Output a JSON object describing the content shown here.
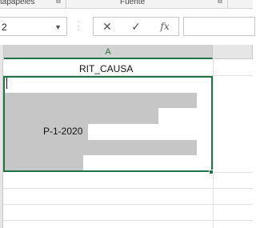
{
  "ribbon": {
    "group_clipboard": "tapapeles",
    "group_font": "Fuente",
    "launcher_icon": "dialog-launcher-icon"
  },
  "formula_bar": {
    "name_box_value": "2",
    "cancel_icon": "✕",
    "enter_icon": "✓",
    "function_icon": "fx",
    "formula_value": ""
  },
  "sheet": {
    "columns": [
      "A"
    ],
    "header_text": "RIT_CAUSA",
    "cell_value": "P-1-2020",
    "accent_color": "#217346"
  }
}
